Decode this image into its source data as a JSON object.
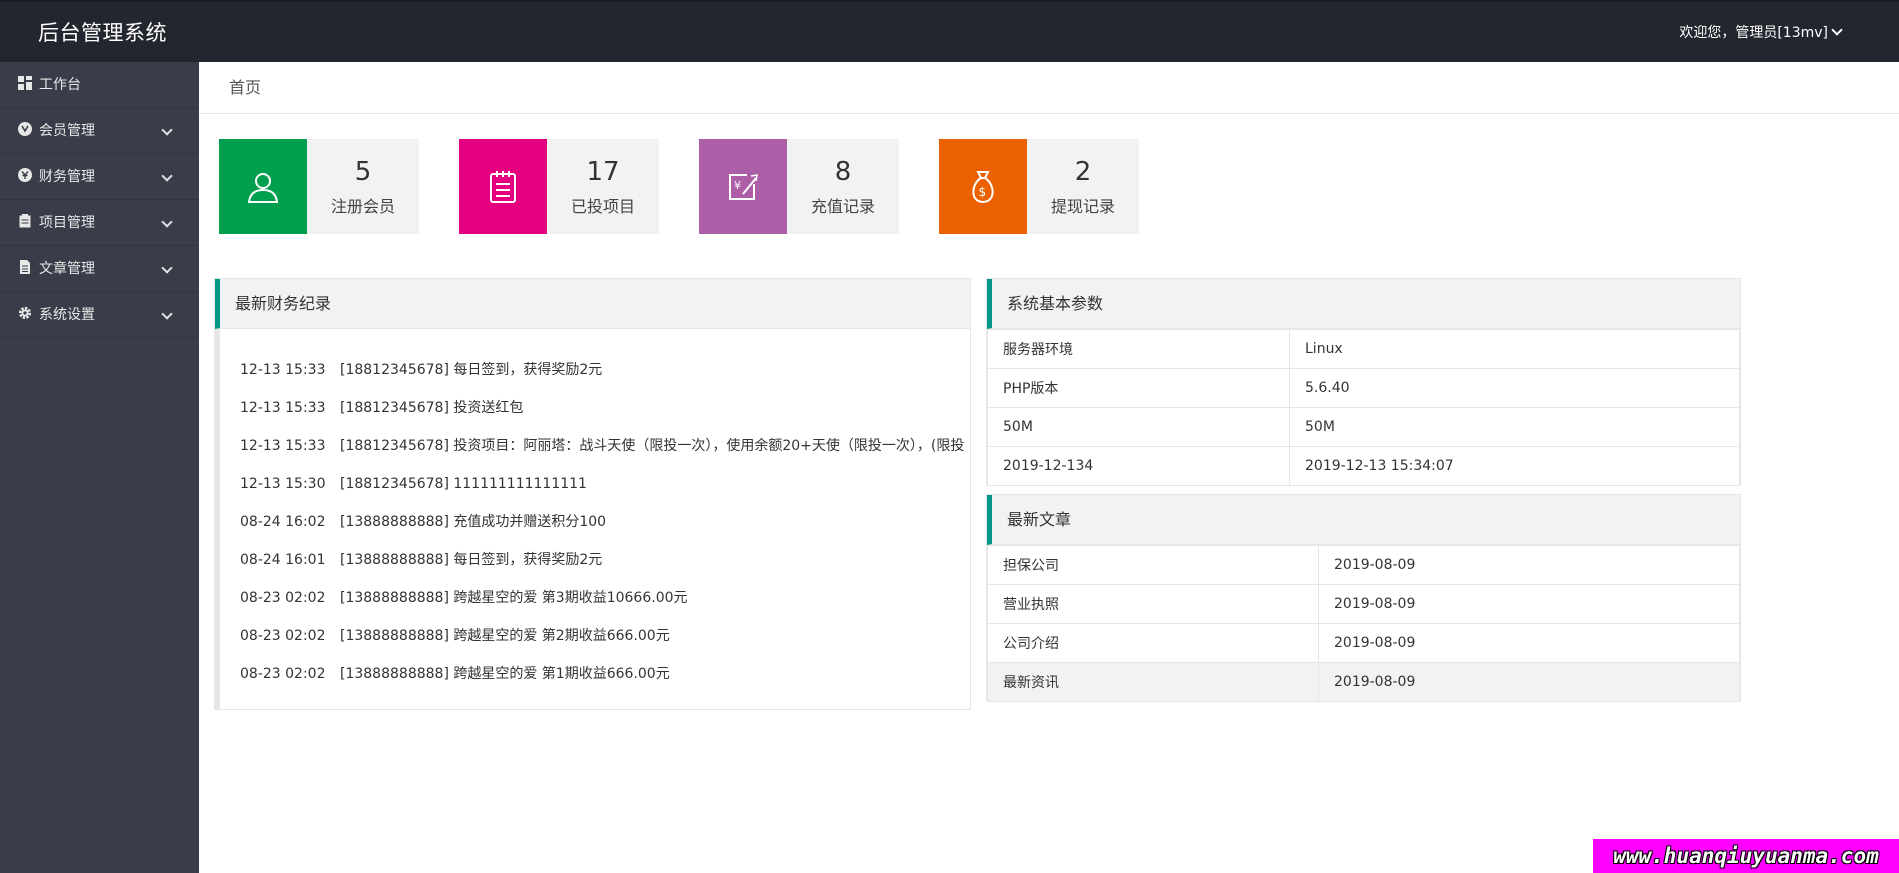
{
  "header": {
    "logo": "后台管理系统",
    "user": "欢迎您，管理员[13mv]"
  },
  "sidebar": {
    "items": [
      {
        "label": "工作台",
        "icon": "dashboard-icon"
      },
      {
        "label": "会员管理",
        "icon": "member-icon"
      },
      {
        "label": "财务管理",
        "icon": "finance-icon"
      },
      {
        "label": "项目管理",
        "icon": "project-icon"
      },
      {
        "label": "文章管理",
        "icon": "article-icon"
      },
      {
        "label": "系统设置",
        "icon": "gear-icon"
      }
    ]
  },
  "breadcrumb": "首页",
  "stats": [
    {
      "value": "5",
      "label": "注册会员",
      "color": "#009f4d",
      "icon": "user-icon"
    },
    {
      "value": "17",
      "label": "已投项目",
      "color": "#e4007f",
      "icon": "notepad-icon"
    },
    {
      "value": "8",
      "label": "充值记录",
      "color": "#ac5ea6",
      "icon": "recharge-icon"
    },
    {
      "value": "2",
      "label": "提现记录",
      "color": "#eb6100",
      "icon": "money-bag-icon"
    }
  ],
  "finance": {
    "title": "最新财务纪录",
    "rows": [
      {
        "time": "12-13 15:33",
        "text": "[18812345678] 每日签到，获得奖励2元"
      },
      {
        "time": "12-13 15:33",
        "text": "[18812345678] 投资送红包"
      },
      {
        "time": "12-13 15:33",
        "text": "[18812345678] 投资项目：阿丽塔：战斗天使（限投一次），使用余额20+天使（限投一次），(限投"
      },
      {
        "time": "12-13 15:30",
        "text": "[18812345678] 111111111111111"
      },
      {
        "time": "08-24 16:02",
        "text": "[13888888888] 充值成功并赠送积分100"
      },
      {
        "time": "08-24 16:01",
        "text": "[13888888888] 每日签到，获得奖励2元"
      },
      {
        "time": "08-23 02:02",
        "text": "[13888888888] 跨越星空的爱 第3期收益10666.00元"
      },
      {
        "time": "08-23 02:02",
        "text": "[13888888888] 跨越星空的爱 第2期收益666.00元"
      },
      {
        "time": "08-23 02:02",
        "text": "[13888888888] 跨越星空的爱 第1期收益666.00元"
      }
    ]
  },
  "sysinfo": {
    "title": "系统基本参数",
    "rows": [
      {
        "key": "服务器环境",
        "value": "Linux"
      },
      {
        "key": "PHP版本",
        "value": "5.6.40"
      },
      {
        "key": "50M",
        "value": "50M"
      },
      {
        "key": "2019-12-134",
        "value": "2019-12-13 15:34:07"
      }
    ]
  },
  "articles": {
    "title": "最新文章",
    "rows": [
      {
        "key": "担保公司",
        "value": "2019-08-09"
      },
      {
        "key": "营业执照",
        "value": "2019-08-09"
      },
      {
        "key": "公司介绍",
        "value": "2019-08-09"
      },
      {
        "key": "最新资讯",
        "value": "2019-08-09"
      }
    ]
  },
  "watermark": "www.huanqiuyuanma.com"
}
